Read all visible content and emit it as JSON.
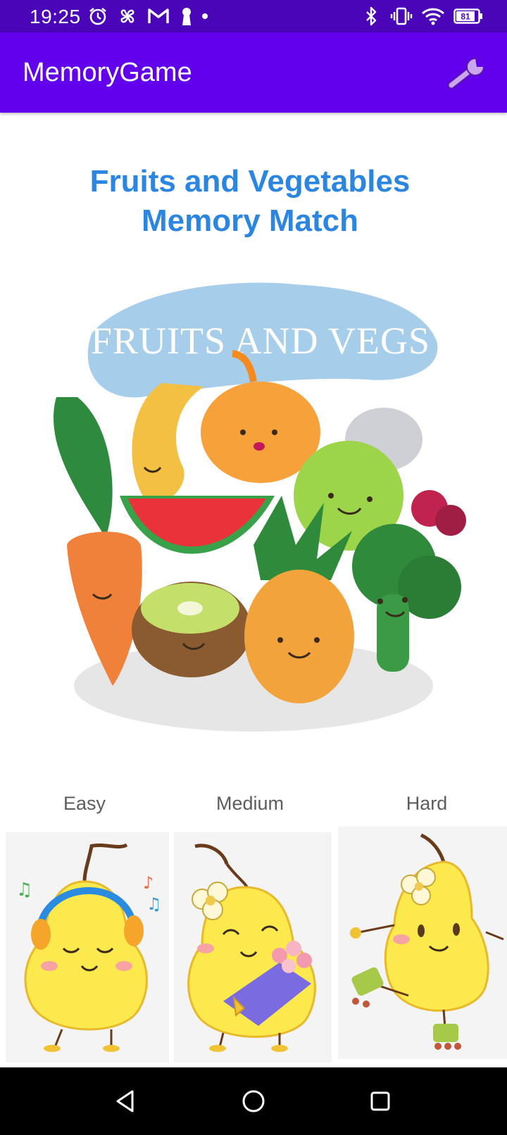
{
  "status_bar": {
    "time": "19:25",
    "battery": "81",
    "icons": [
      "alarm-icon",
      "pinwheel-icon",
      "gmail-icon",
      "keyhole-icon",
      "dot-icon",
      "bluetooth-icon",
      "vibrate-icon",
      "wifi-icon",
      "battery-icon"
    ]
  },
  "app_bar": {
    "title": "MemoryGame",
    "settings_icon": "wrench-icon"
  },
  "main": {
    "title_line1": "Fruits and Vegetables",
    "title_line2": "Memory Match",
    "hero_text": "FRUITS AND VEGS"
  },
  "difficulty": {
    "easy_label": "Easy",
    "medium_label": "Medium",
    "hard_label": "Hard"
  },
  "nav": {
    "icons": [
      "back-icon",
      "home-icon",
      "recents-icon"
    ]
  },
  "colors": {
    "status_bar": "#4a05b8",
    "app_bar": "#6200ee",
    "title": "#2a86e0",
    "label": "#5c5c5c"
  }
}
